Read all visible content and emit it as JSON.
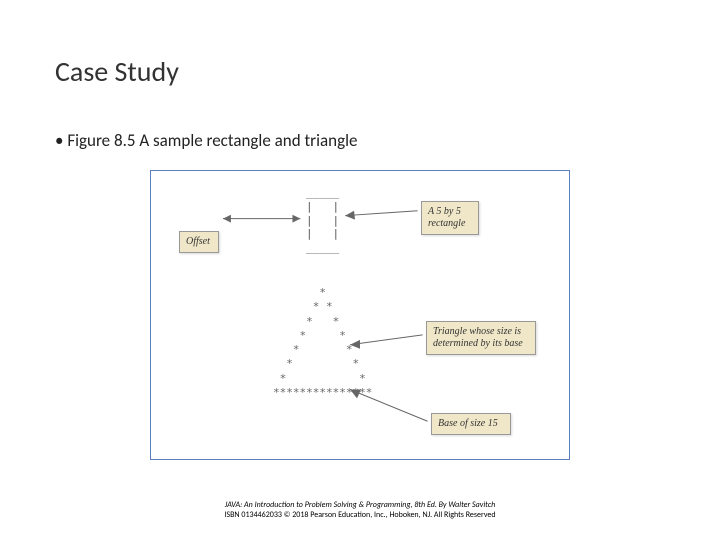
{
  "slide": {
    "title": "Case Study",
    "bullet": "Figure 8.5 A sample rectangle and triangle"
  },
  "figure": {
    "labels": {
      "offset": "Offset",
      "rectangle": "A 5 by 5 rectangle",
      "triangle": "Triangle whose size is determined by its base",
      "base": "Base of size 15"
    },
    "ascii": {
      "rectangle": "_____\n|   |\n|   |\n|   |\n_____",
      "triangle": "       *\n      * *\n     *   *\n    *     *\n   *       *\n  *         *\n *           *\n***************"
    }
  },
  "footer": {
    "line1": "JAVA: An Introduction to Problem Solving & Programming, 8th Ed. By Walter Savitch",
    "line2": "ISBN 0134462033  © 2018 Pearson Education, Inc., Hoboken, NJ. All Rights Reserved"
  }
}
